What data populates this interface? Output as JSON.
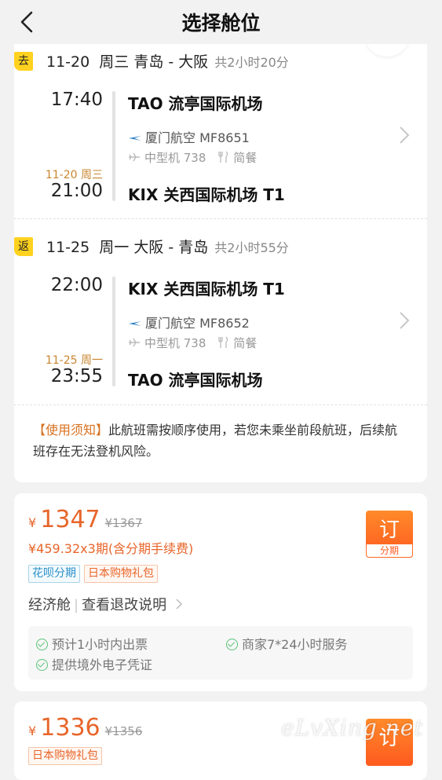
{
  "nav": {
    "title": "选择舱位"
  },
  "outbound": {
    "tag": "去",
    "route": "11-20  周三 青岛 - 大阪",
    "duration": "共2小时20分",
    "dep_time": "17:40",
    "dep_airport": "TAO 流亭国际机场",
    "airline": "厦门航空 MF8651",
    "aircraft": "中型机 738",
    "meal": "简餐",
    "arr_date": "11-20 周三",
    "arr_time": "21:00",
    "arr_airport": "KIX 关西国际机场 T1"
  },
  "return": {
    "tag": "返",
    "route": "11-25  周一 大阪 - 青岛",
    "duration": "共2小时55分",
    "dep_time": "22:00",
    "dep_airport": "KIX 关西国际机场 T1",
    "airline": "厦门航空 MF8652",
    "aircraft": "中型机 738",
    "meal": "简餐",
    "arr_date": "11-25 周一",
    "arr_time": "23:55",
    "arr_airport": "TAO 流亭国际机场"
  },
  "notice": {
    "label": "【使用须知】",
    "text": "此航班需按顺序使用，若您未乘坐前段航班，后续航班存在无法登机风险。"
  },
  "offers": [
    {
      "currency": "¥",
      "price": "1347",
      "old_price": "¥1367",
      "installment": "¥459.32x3期(含分期手续费)",
      "badges": [
        "花呗分期",
        "日本购物礼包"
      ],
      "cabin": "经济舱",
      "refund_link": "查看退改说明",
      "services": [
        "预计1小时内出票",
        "商家7*24小时服务",
        "提供境外电子凭证"
      ],
      "book_label": "订",
      "book_sub": "分期"
    },
    {
      "currency": "¥",
      "price": "1336",
      "old_price": "¥1356",
      "badges": [
        "日本购物礼包"
      ],
      "book_label": "订"
    }
  ],
  "watermark": "eLvXing.net",
  "colors": {
    "accent": "#e8652a",
    "tag_yellow": "#ffd21f",
    "date_orange": "#c9852e",
    "badge_blue": "#2a90c8"
  }
}
